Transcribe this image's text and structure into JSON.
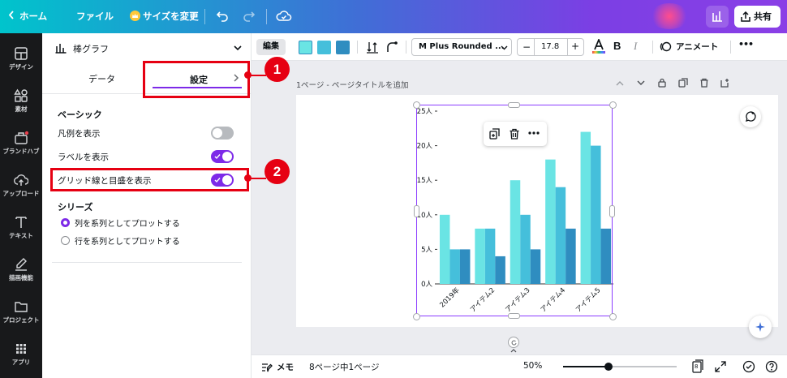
{
  "topbar": {
    "home": "ホーム",
    "file": "ファイル",
    "resize": "サイズを変更",
    "share": "共有"
  },
  "rail": [
    {
      "label": "デザイン",
      "icon": "layout-icon"
    },
    {
      "label": "素材",
      "icon": "elements-icon"
    },
    {
      "label": "ブランドハブ",
      "icon": "brand-icon"
    },
    {
      "label": "アップロード",
      "icon": "upload-icon"
    },
    {
      "label": "テキスト",
      "icon": "text-icon"
    },
    {
      "label": "描画機能",
      "icon": "draw-icon"
    },
    {
      "label": "プロジェクト",
      "icon": "folder-icon"
    },
    {
      "label": "アプリ",
      "icon": "apps-icon"
    }
  ],
  "panel": {
    "chart_type": "棒グラフ",
    "tabs": {
      "data": "データ",
      "settings": "設定"
    },
    "basic_heading": "ベーシック",
    "toggles": [
      {
        "label": "凡例を表示",
        "on": false
      },
      {
        "label": "ラベルを表示",
        "on": true
      },
      {
        "label": "グリッド線と目盛を表示",
        "on": true
      }
    ],
    "series_heading": "シリーズ",
    "radios": [
      {
        "label": "列を系列としてプロットする",
        "selected": true
      },
      {
        "label": "行を系列としてプロットする",
        "selected": false
      }
    ]
  },
  "callouts": [
    "1",
    "2"
  ],
  "toolbar": {
    "edit": "編集",
    "font": "M Plus Rounded ...",
    "font_size": "17.8",
    "minus": "−",
    "plus": "+",
    "bold": "B",
    "italic": "I",
    "animate": "アニメート",
    "more": "•••",
    "swatches": [
      "#6ae4e4",
      "#45bfdb",
      "#2f8dc0"
    ]
  },
  "page": {
    "title": "1ページ - ページタイトルを追加"
  },
  "colors": {
    "accent": "#7d2ae8",
    "brand": "#00c4cc",
    "annotation": "#e60012",
    "toggle_off": "#b7babe"
  },
  "status": {
    "notes": "メモ",
    "pages": "8ページ中1ページ",
    "zoom": "50%",
    "zoom_fraction": 0.4,
    "page_count": "8"
  },
  "chart_data": {
    "type": "bar",
    "categories": [
      "2019年",
      "アイテム2",
      "アイテム3",
      "アイテム4",
      "アイテム5"
    ],
    "series": [
      {
        "values": [
          10,
          8,
          15,
          18,
          22
        ],
        "color": "#6ae4e4"
      },
      {
        "values": [
          5,
          8,
          10,
          14,
          20
        ],
        "color": "#45bfdb"
      },
      {
        "values": [
          5,
          4,
          5,
          8,
          8
        ],
        "color": "#2f8dc0"
      }
    ],
    "yticks": [
      "0人",
      "5人",
      "10人",
      "15人",
      "20人",
      "25人"
    ],
    "ylim": [
      0,
      25
    ],
    "grid": false,
    "legend": false
  }
}
